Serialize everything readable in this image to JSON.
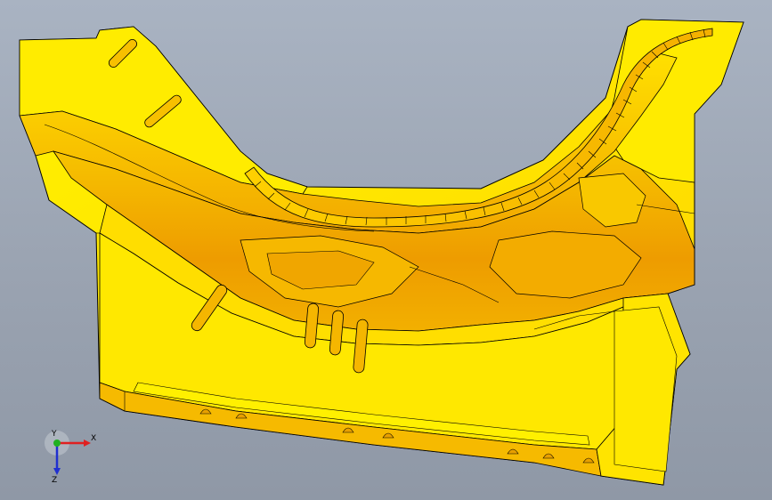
{
  "viewport": {
    "background_top": "#a9b3c2",
    "background_bottom": "#8f98a6"
  },
  "model": {
    "face_color": "#ffe600",
    "shade_color": "#f0b400",
    "deep_color": "#e39400",
    "edge_color": "#000000"
  },
  "triad": {
    "x_label": "X",
    "y_label": "Y",
    "z_label": "Z",
    "x_color": "#e02020",
    "y_color": "#20b020",
    "z_color": "#2030d0"
  }
}
